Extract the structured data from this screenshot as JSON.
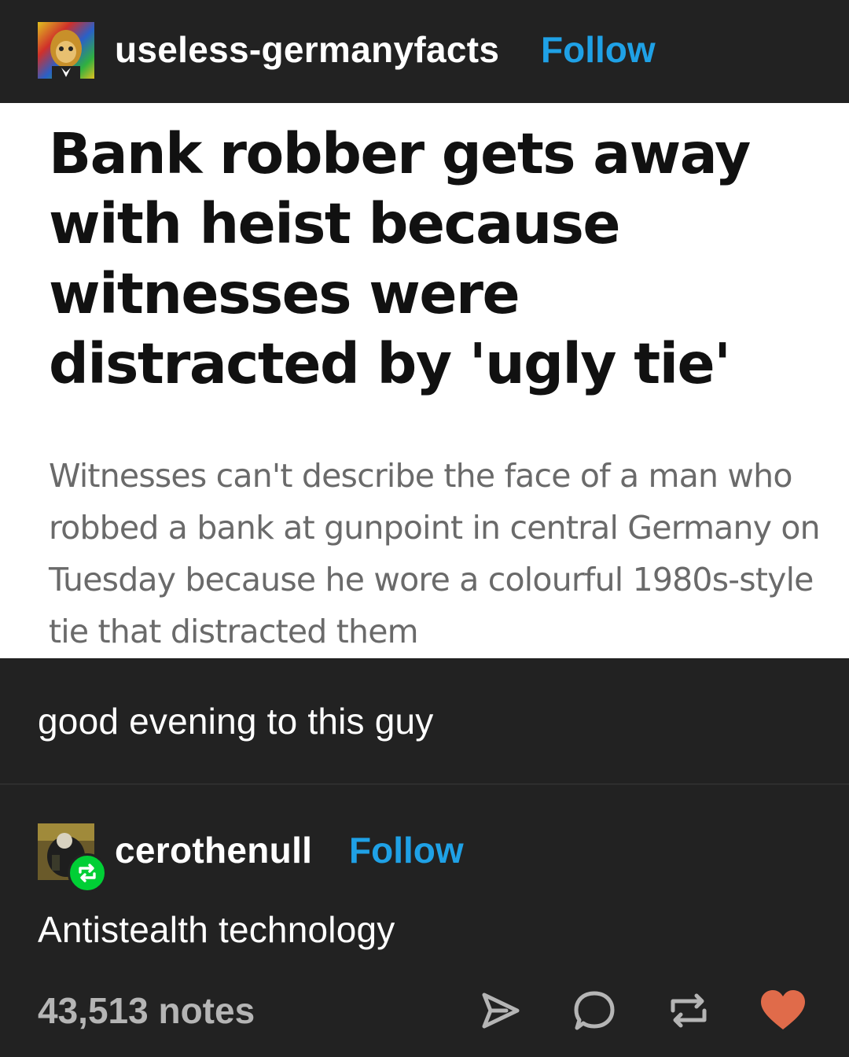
{
  "post": {
    "author": "useless-germanyfacts",
    "follow_label": "Follow"
  },
  "article": {
    "headline": "Bank robber gets away with heist because witnesses were distracted by 'ugly tie'",
    "subtext": "Witnesses can't describe the face of a man who robbed a bank at gunpoint in central Germany on Tuesday because he wore a colourful 1980s-style tie that distracted them"
  },
  "comment_original": "good evening to this guy",
  "reblog": {
    "author": "cerothenull",
    "follow_label": "Follow",
    "comment": "Antistealth technology"
  },
  "footer": {
    "notes": "43,513 notes",
    "icons": [
      "share-icon",
      "reply-icon",
      "reblog-icon",
      "like-icon"
    ]
  },
  "colors": {
    "background": "#222222",
    "follow": "#1fa1e6",
    "reblog_badge": "#00cf35",
    "like": "#e06b4a"
  }
}
